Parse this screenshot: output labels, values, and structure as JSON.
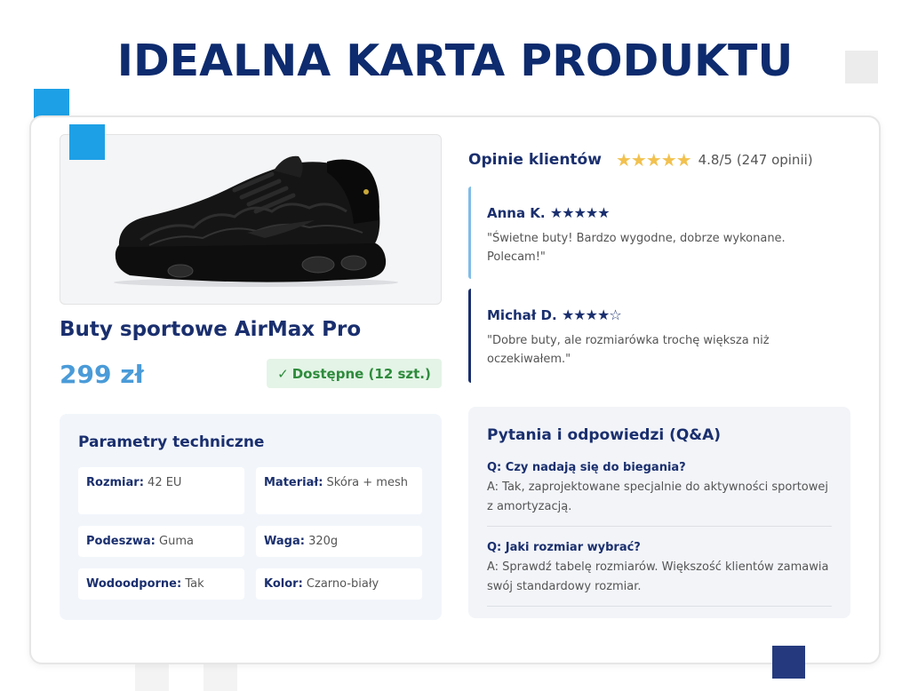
{
  "page": {
    "title": "IDEALNA KARTA PRODUKTU"
  },
  "colors": {
    "brand_navy": "#1a2f6e",
    "price_blue": "#4a9bd8",
    "accent_blue": "#1ea0e6",
    "star_gold": "#f2c14e",
    "stock_green": "#2e8b3c",
    "stock_bg": "#e4f4e7"
  },
  "product": {
    "image_icon": "sneaker-image",
    "name": "Buty sportowe AirMax Pro",
    "price": "299 zł",
    "stock_check": "✓",
    "stock": "Dostępne (12 szt.)"
  },
  "params": {
    "title": "Parametry techniczne",
    "items": [
      {
        "label": "Rozmiar:",
        "value": "42 EU"
      },
      {
        "label": "Materiał:",
        "value": "Skóra + mesh"
      },
      {
        "label": "Podeszwa:",
        "value": "Guma"
      },
      {
        "label": "Waga:",
        "value": "320g"
      },
      {
        "label": "Wodoodporne:",
        "value": "Tak"
      },
      {
        "label": "Kolor:",
        "value": "Czarno-biały"
      }
    ]
  },
  "reviews": {
    "title": "Opinie klientów",
    "stars": "★★★★★",
    "rating": 4.8,
    "score": "4.8/5 (247 opinii)",
    "items": [
      {
        "author": "Anna K.",
        "stars": "★★★★★",
        "rating": 5,
        "text": "\"Świetne buty! Bardzo wygodne, dobrze wykonane. Polecam!\""
      },
      {
        "author": "Michał D.",
        "stars": "★★★★☆",
        "rating": 4,
        "text": "\"Dobre buty, ale rozmiarówka trochę większa niż oczekiwałem.\""
      }
    ]
  },
  "qa": {
    "title": "Pytania i odpowiedzi (Q&A)",
    "items": [
      {
        "q": "Q: Czy nadają się do biegania?",
        "a": "A: Tak, zaprojektowane specjalnie do aktywności sportowej z amortyzacją."
      },
      {
        "q": "Q: Jaki rozmiar wybrać?",
        "a": "A: Sprawdź tabelę rozmiarów. Większość klientów zamawia swój standardowy rozmiar."
      }
    ]
  }
}
